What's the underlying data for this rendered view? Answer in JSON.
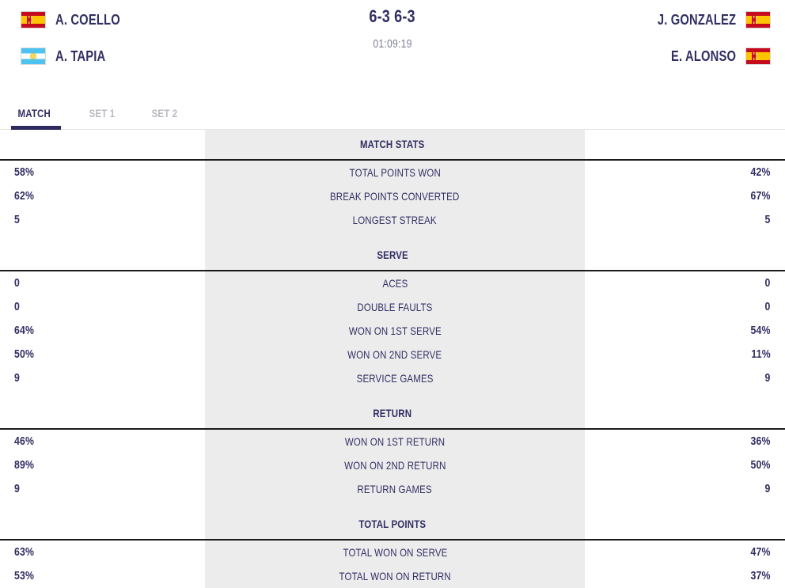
{
  "scoreboard": {
    "team_home": {
      "players": [
        {
          "name": "A. COELLO",
          "flag": "spain-flag"
        },
        {
          "name": "A. TAPIA",
          "flag": "argentina-flag"
        }
      ]
    },
    "team_away": {
      "players": [
        {
          "name": "J. GONZALEZ",
          "flag": "spain-flag"
        },
        {
          "name": "E. ALONSO",
          "flag": "spain-flag"
        }
      ]
    },
    "score": "6-3 6-3",
    "duration": "01:09:19"
  },
  "tabs": [
    {
      "label": "MATCH",
      "active": true
    },
    {
      "label": "SET 1",
      "active": false
    },
    {
      "label": "SET 2",
      "active": false
    }
  ],
  "colors": {
    "text_primary": "#312e63",
    "tab_inactive": "#b8b8c2",
    "tab_underline": "#2c2a5e",
    "band_background": "#ececec",
    "section_rule": "#1b1b1b",
    "time_text": "#7f7f96"
  },
  "sections": [
    {
      "title": "MATCH STATS",
      "rows": [
        {
          "home": "58%",
          "label": "TOTAL POINTS WON",
          "away": "42%"
        },
        {
          "home": "62%",
          "label": "BREAK POINTS CONVERTED",
          "away": "67%"
        },
        {
          "home": "5",
          "label": "LONGEST STREAK",
          "away": "5"
        }
      ]
    },
    {
      "title": "SERVE",
      "rows": [
        {
          "home": "0",
          "label": "ACES",
          "away": "0"
        },
        {
          "home": "0",
          "label": "DOUBLE FAULTS",
          "away": "0"
        },
        {
          "home": "64%",
          "label": "WON ON 1ST SERVE",
          "away": "54%"
        },
        {
          "home": "50%",
          "label": "WON ON 2ND SERVE",
          "away": "11%"
        },
        {
          "home": "9",
          "label": "SERVICE GAMES",
          "away": "9"
        }
      ]
    },
    {
      "title": "RETURN",
      "rows": [
        {
          "home": "46%",
          "label": "WON ON 1ST RETURN",
          "away": "36%"
        },
        {
          "home": "89%",
          "label": "WON ON 2ND RETURN",
          "away": "50%"
        },
        {
          "home": "9",
          "label": "RETURN GAMES",
          "away": "9"
        }
      ]
    },
    {
      "title": "TOTAL POINTS",
      "rows": [
        {
          "home": "63%",
          "label": "TOTAL WON ON SERVE",
          "away": "47%"
        },
        {
          "home": "53%",
          "label": "TOTAL WON ON RETURN",
          "away": "37%"
        }
      ]
    }
  ]
}
